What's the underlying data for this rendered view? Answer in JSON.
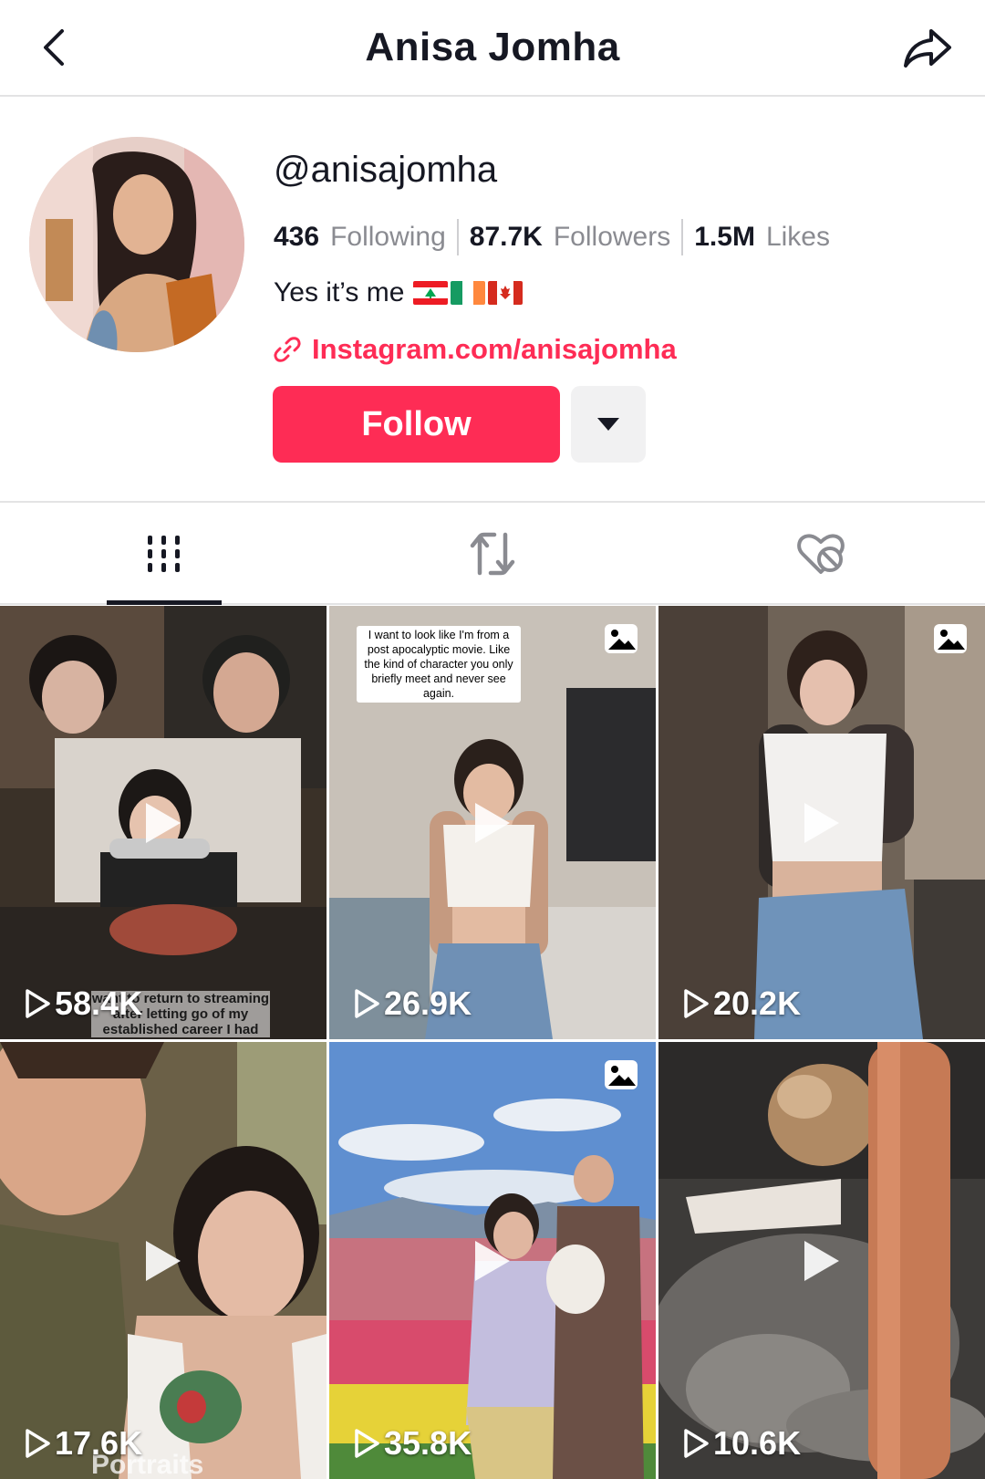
{
  "header": {
    "title": "Anisa Jomha",
    "back_icon": "chevron-left-icon",
    "share_icon": "share-arrow-icon"
  },
  "profile": {
    "handle": "@anisajomha",
    "stats": [
      {
        "value": "436",
        "label": "Following"
      },
      {
        "value": "87.7K",
        "label": "Followers"
      },
      {
        "value": "1.5M",
        "label": "Likes"
      }
    ],
    "bio_text": "Yes it’s me",
    "bio_flags": [
      "lebanon-flag",
      "ireland-flag",
      "canada-flag"
    ],
    "link": "Instagram.com/anisajomha",
    "follow_label": "Follow",
    "accent_color": "#fe2c55"
  },
  "tabs": [
    {
      "name": "videos-tab",
      "icon": "grid-lines-icon",
      "active": true
    },
    {
      "name": "reposts-tab",
      "icon": "repost-arrows-icon",
      "active": false
    },
    {
      "name": "liked-tab",
      "icon": "hidden-heart-icon",
      "active": false
    }
  ],
  "videos": [
    {
      "views": "58.4K",
      "type": "video",
      "overlay": "want to return to streaming after letting go of my established career I had"
    },
    {
      "views": "26.9K",
      "type": "photo",
      "caption": "I want to look like I'm from a post apocalyptic movie.  Like the kind of character you only briefly meet and never see again."
    },
    {
      "views": "20.2K",
      "type": "photo"
    },
    {
      "views": "17.6K",
      "type": "video",
      "overlay": "Portraits"
    },
    {
      "views": "35.8K",
      "type": "photo"
    },
    {
      "views": "10.6K",
      "type": "video"
    }
  ]
}
